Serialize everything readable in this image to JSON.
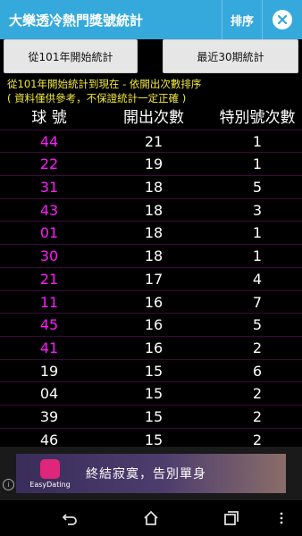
{
  "header": {
    "title": "大樂透冷熱門獎號統計",
    "sort_label": "排序"
  },
  "buttons": {
    "from_101": "從101年開始統計",
    "recent_30": "最近30期統計"
  },
  "notes": {
    "line1": "從101年開始統計到現在 - 依開出次數排序",
    "line2": "( 資料僅供參考，不保證統計一定正確 )"
  },
  "table": {
    "headers": [
      "球 號",
      "開出次數",
      "特別號次數"
    ],
    "rows": [
      {
        "ball": "44",
        "count": "21",
        "special": "1"
      },
      {
        "ball": "22",
        "count": "19",
        "special": "1"
      },
      {
        "ball": "31",
        "count": "18",
        "special": "5"
      },
      {
        "ball": "43",
        "count": "18",
        "special": "3"
      },
      {
        "ball": "01",
        "count": "18",
        "special": "1"
      },
      {
        "ball": "30",
        "count": "18",
        "special": "1"
      },
      {
        "ball": "21",
        "count": "17",
        "special": "4"
      },
      {
        "ball": "11",
        "count": "16",
        "special": "7"
      },
      {
        "ball": "45",
        "count": "16",
        "special": "5"
      },
      {
        "ball": "41",
        "count": "16",
        "special": "2"
      },
      {
        "ball": "19",
        "count": "15",
        "special": "6"
      },
      {
        "ball": "04",
        "count": "15",
        "special": "2"
      },
      {
        "ball": "39",
        "count": "15",
        "special": "2"
      },
      {
        "ball": "46",
        "count": "15",
        "special": "2"
      }
    ]
  },
  "ad": {
    "brand": "EasyDating",
    "text": "終結寂寞，告別單身",
    "info": "i"
  },
  "colors": {
    "titlebar": "#36a9dc",
    "highlight": "#ff1aff",
    "note": "#f2ea3c"
  },
  "icons": {
    "close": "close-icon",
    "back": "back-icon",
    "home": "home-icon",
    "recents": "recents-icon",
    "menu": "menu-icon"
  }
}
